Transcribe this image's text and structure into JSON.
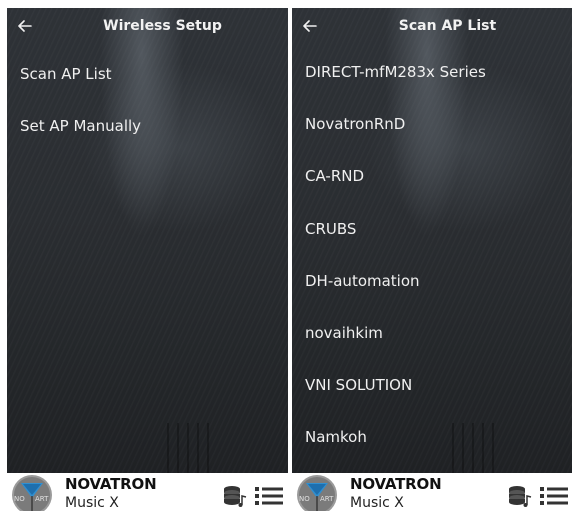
{
  "left_screen": {
    "header": {
      "title": "Wireless Setup",
      "back_icon": "arrow-left-icon"
    },
    "items": [
      {
        "label": "Scan AP List"
      },
      {
        "label": "Set AP Manually"
      }
    ]
  },
  "right_screen": {
    "header": {
      "title": "Scan AP List",
      "back_icon": "arrow-left-icon"
    },
    "items": [
      {
        "label": "DIRECT-mfM283x Series"
      },
      {
        "label": "NovatronRnD"
      },
      {
        "label": "CA-RND"
      },
      {
        "label": "CRUBS"
      },
      {
        "label": "DH-automation"
      },
      {
        "label": "novaihkim"
      },
      {
        "label": "VNI SOLUTION"
      },
      {
        "label": "Namkoh"
      }
    ]
  },
  "footer": {
    "brand": "NOVATRON",
    "product": "Music X",
    "logo_text_left": "NO",
    "logo_text_right": "ART",
    "icons": [
      "music-library-icon",
      "playlist-icon"
    ]
  },
  "colors": {
    "text_light": "#f0f0f0",
    "background_dark": "#2a2d31",
    "logo_blue": "#2f8fd1",
    "footer_bg": "#ffffff"
  }
}
